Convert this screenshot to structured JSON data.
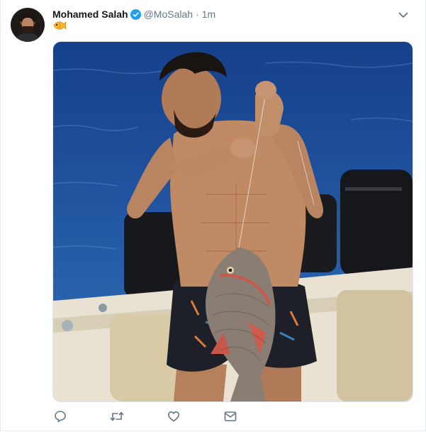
{
  "tweet": {
    "author_name": "Mohamed Salah",
    "handle": "@MoSalah",
    "separator": "·",
    "timestamp": "1m",
    "verified": true,
    "text_emoji": "fish-emoji",
    "media_description": "photo"
  },
  "icons": {
    "reply": "reply-icon",
    "retweet": "retweet-icon",
    "like": "like-icon",
    "message": "direct-message-icon",
    "caret": "chevron-down-icon",
    "verified": "verified-badge-icon"
  },
  "colors": {
    "verified": "#1da1f2",
    "secondary_text": "#657786",
    "icon": "#657786"
  }
}
